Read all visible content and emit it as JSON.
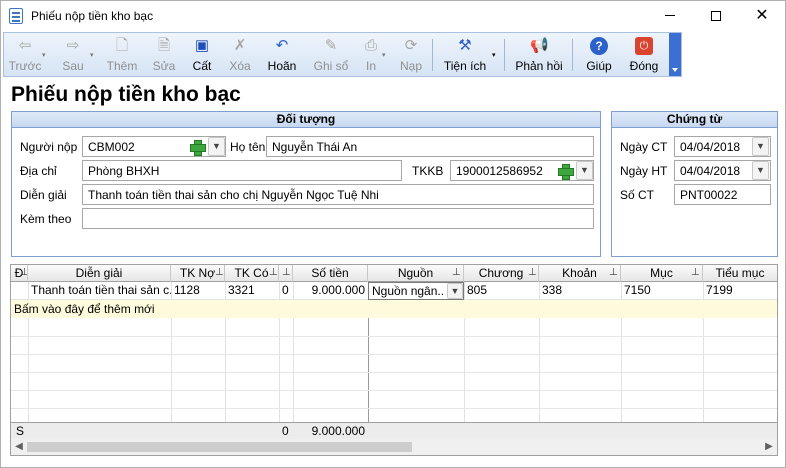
{
  "window": {
    "title": "Phiếu nộp tiền kho bạc",
    "controls": {
      "minimize": "",
      "maximize": "",
      "close": "✕"
    }
  },
  "toolbar": {
    "items": [
      {
        "label": "Trước",
        "icon": "arrow-left-icon",
        "enabled": false
      },
      {
        "label": "Sau",
        "icon": "arrow-right-icon",
        "enabled": false
      },
      {
        "label": "Thêm",
        "icon": "add-document-icon",
        "enabled": false
      },
      {
        "label": "Sửa",
        "icon": "edit-document-icon",
        "enabled": false
      },
      {
        "label": "Cất",
        "icon": "floppy-disk-icon",
        "enabled": true
      },
      {
        "label": "Xóa",
        "icon": "delete-document-icon",
        "enabled": false
      },
      {
        "label": "Hoãn",
        "icon": "undo-icon",
        "enabled": true
      },
      {
        "label": "Ghi sổ",
        "icon": "pencil-icon",
        "enabled": false
      },
      {
        "label": "In",
        "icon": "printer-icon",
        "enabled": false
      },
      {
        "label": "Nạp",
        "icon": "reload-icon",
        "enabled": false
      },
      {
        "label": "Tiện ích",
        "icon": "tools-icon",
        "enabled": true
      },
      {
        "label": "Phản hồi",
        "icon": "megaphone-icon",
        "enabled": true
      },
      {
        "label": "Giúp",
        "icon": "help-icon",
        "enabled": true
      },
      {
        "label": "Đóng",
        "icon": "power-icon",
        "enabled": true
      }
    ]
  },
  "page_title": "Phiếu nộp tiền kho bạc",
  "doi_tuong": {
    "header": "Đối tượng",
    "nguoi_nop_label": "Người nộp",
    "nguoi_nop_value": "CBM002",
    "ho_ten_label": "Họ tên",
    "ho_ten_value": "Nguyễn Thái An",
    "dia_chi_label": "Địa chỉ",
    "dia_chi_value": "Phòng BHXH",
    "tkkb_label": "TKKB",
    "tkkb_value": "1900012586952",
    "dien_giai_label": "Diễn giải",
    "dien_giai_value": "Thanh toán tiền thai sản cho chị Nguyễn Ngọc Tuệ Nhi",
    "kem_theo_label": "Kèm theo",
    "kem_theo_value": ""
  },
  "chung_tu": {
    "header": "Chứng từ",
    "ngay_ct_label": "Ngày CT",
    "ngay_ct_value": "04/04/2018",
    "ngay_ht_label": "Ngày HT",
    "ngay_ht_value": "04/04/2018",
    "so_ct_label": "Số CT",
    "so_ct_value": "PNT00022"
  },
  "grid": {
    "columns": {
      "d": "Đ",
      "dien_giai": "Diễn giải",
      "tk_no": "TK Nợ",
      "tk_co": "TK Có",
      "blank": "",
      "so_tien": "Số tiền",
      "nguon": "Nguồn",
      "chuong": "Chương",
      "khoan": "Khoản",
      "muc": "Mục",
      "tieu_muc": "Tiểu mục"
    },
    "row": {
      "dien_giai": "Thanh toán tiền thai sản c...",
      "tk_no": "1128",
      "tk_co": "3321",
      "blank": "0",
      "so_tien": "9.000.000",
      "nguon": "Nguồn ngân...",
      "chuong": "805",
      "khoan": "338",
      "muc": "7150",
      "tieu_muc": "7199"
    },
    "new_row_hint": "Bấm vào đây để thêm mới",
    "footer": {
      "label": "S",
      "blank_total": "0",
      "so_tien_total": "9.000.000"
    }
  },
  "colors": {
    "accent": "#3b6fd1",
    "group_border": "#7e9fd0",
    "new_row_bg": "#fdfbdc"
  }
}
